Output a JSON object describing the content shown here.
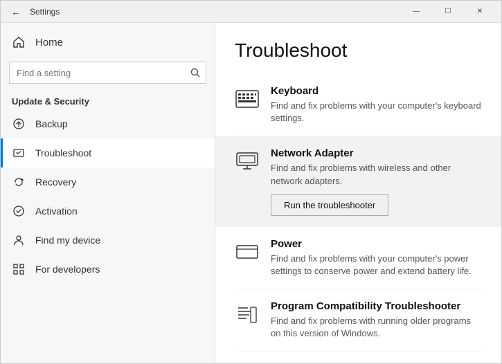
{
  "window": {
    "title": "Settings",
    "controls": {
      "minimize": "—",
      "maximize": "☐",
      "close": "✕"
    }
  },
  "sidebar": {
    "home_label": "Home",
    "search_placeholder": "Find a setting",
    "section_label": "Update & Security",
    "nav_items": [
      {
        "id": "backup",
        "label": "Backup",
        "icon": "backup-icon"
      },
      {
        "id": "troubleshoot",
        "label": "Troubleshoot",
        "icon": "troubleshoot-icon",
        "active": true
      },
      {
        "id": "recovery",
        "label": "Recovery",
        "icon": "recovery-icon"
      },
      {
        "id": "activation",
        "label": "Activation",
        "icon": "activation-icon"
      },
      {
        "id": "finddevice",
        "label": "Find my device",
        "icon": "finddevice-icon"
      },
      {
        "id": "developers",
        "label": "For developers",
        "icon": "developers-icon"
      }
    ]
  },
  "main": {
    "page_title": "Troubleshoot",
    "items": [
      {
        "id": "keyboard",
        "title": "Keyboard",
        "desc": "Find and fix problems with your computer's keyboard settings.",
        "highlighted": false,
        "show_button": false
      },
      {
        "id": "network-adapter",
        "title": "Network Adapter",
        "desc": "Find and fix problems with wireless and other network adapters.",
        "highlighted": true,
        "show_button": true,
        "button_label": "Run the troubleshooter"
      },
      {
        "id": "power",
        "title": "Power",
        "desc": "Find and fix problems with your computer's power settings to conserve power and extend battery life.",
        "highlighted": false,
        "show_button": false
      },
      {
        "id": "program-compat",
        "title": "Program Compatibility Troubleshooter",
        "desc": "Find and fix problems with running older programs on this version of Windows.",
        "highlighted": false,
        "show_button": false
      }
    ]
  }
}
